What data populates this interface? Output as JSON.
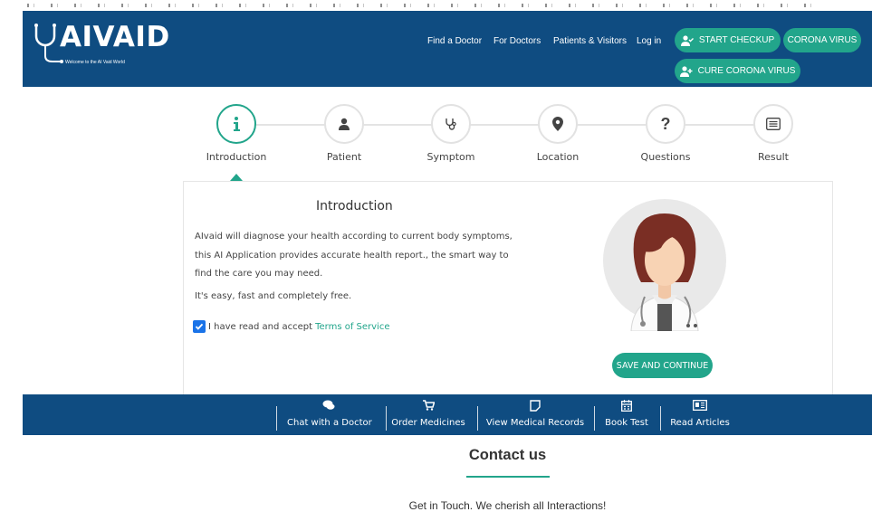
{
  "brand": {
    "name": "AIVAID",
    "tagline": "Welcome to the AI Vaid World"
  },
  "nav": {
    "find_doctor": "Find a Doctor",
    "for_doctors": "For Doctors",
    "patients_visitors": "Patients & Visitors",
    "login": "Log in"
  },
  "buttons": {
    "start_checkup": "START CHECKUP",
    "corona_virus": "CORONA VIRUS",
    "cure_corona": "CURE CORONA VIRUS",
    "save_continue": "SAVE AND CONTINUE"
  },
  "steps": [
    {
      "label": "Introduction",
      "icon": "info-icon",
      "active": true
    },
    {
      "label": "Patient",
      "icon": "person-icon",
      "active": false
    },
    {
      "label": "Symptom",
      "icon": "stethoscope-icon",
      "active": false
    },
    {
      "label": "Location",
      "icon": "location-pin-icon",
      "active": false
    },
    {
      "label": "Questions",
      "icon": "question-icon",
      "active": false
    },
    {
      "label": "Result",
      "icon": "list-icon",
      "active": false
    }
  ],
  "intro": {
    "title": "Introduction",
    "text": "AIvaid will diagnose your health according to current body symptoms, this AI Application provides accurate health report., the smart way to find the care you may need.",
    "easy": "It's easy, fast and completely free.",
    "agree_prefix": "I have read and accept",
    "terms_link": "Terms of Service",
    "agree_checked": true
  },
  "bottom_bar": [
    {
      "label": "Chat with a Doctor",
      "icon": "chat-icon"
    },
    {
      "label": "Order Medicines",
      "icon": "cart-icon"
    },
    {
      "label": "View Medical Records",
      "icon": "record-icon"
    },
    {
      "label": "Book Test",
      "icon": "calendar-icon"
    },
    {
      "label": "Read Articles",
      "icon": "newspaper-icon"
    }
  ],
  "contact": {
    "title": "Contact us",
    "subtitle": "Get in Touch. We cherish all Interactions!"
  },
  "colors": {
    "header": "#0f4c81",
    "accent": "#22a58b",
    "checkbox": "#1a73e8"
  }
}
